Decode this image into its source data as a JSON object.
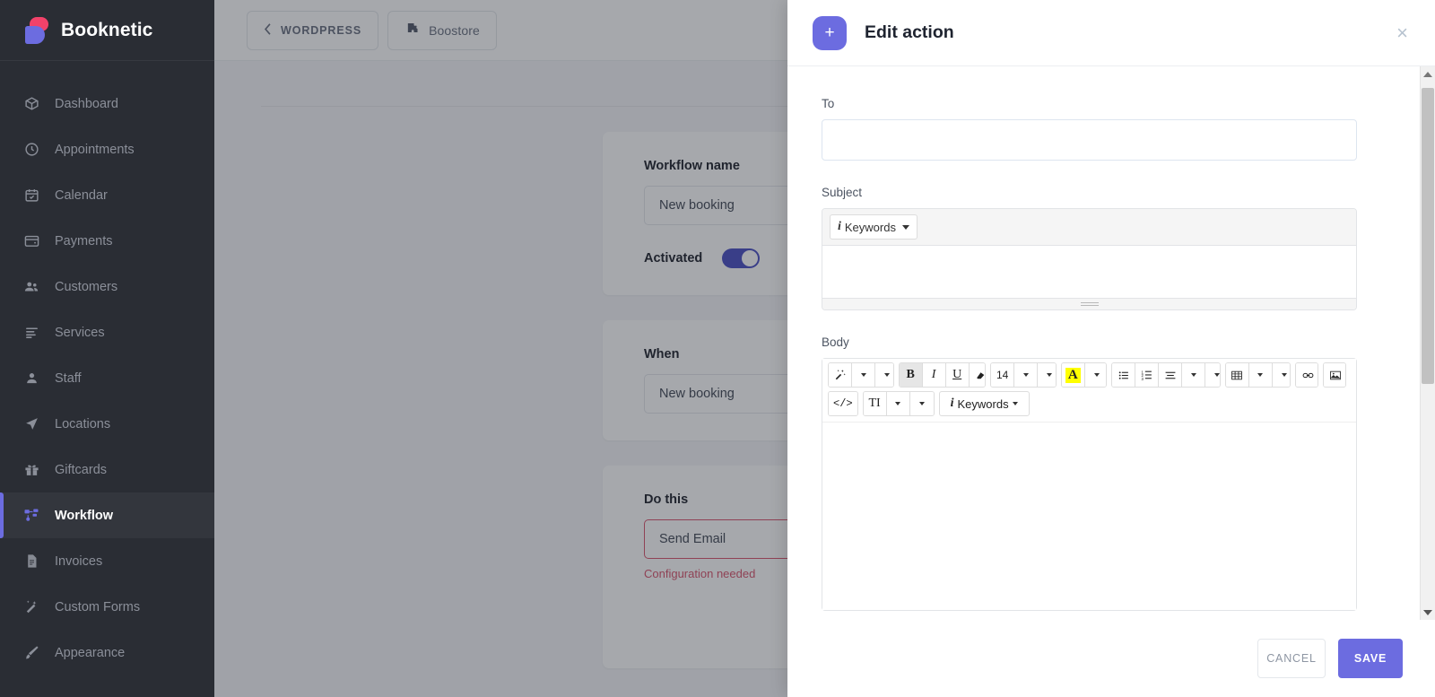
{
  "sidebar": {
    "brand": "Booknetic",
    "items": [
      {
        "label": "Dashboard",
        "icon": "box-icon",
        "active": false
      },
      {
        "label": "Appointments",
        "icon": "clock-icon",
        "active": false
      },
      {
        "label": "Calendar",
        "icon": "calendar-icon",
        "active": false
      },
      {
        "label": "Payments",
        "icon": "wallet-icon",
        "active": false
      },
      {
        "label": "Customers",
        "icon": "users-icon",
        "active": false
      },
      {
        "label": "Services",
        "icon": "list-icon",
        "active": false
      },
      {
        "label": "Staff",
        "icon": "user-icon",
        "active": false
      },
      {
        "label": "Locations",
        "icon": "navigation-icon",
        "active": false
      },
      {
        "label": "Giftcards",
        "icon": "gift-icon",
        "active": false
      },
      {
        "label": "Workflow",
        "icon": "workflow-icon",
        "active": true
      },
      {
        "label": "Invoices",
        "icon": "document-icon",
        "active": false
      },
      {
        "label": "Custom Forms",
        "icon": "magic-wand-icon",
        "active": false
      },
      {
        "label": "Appearance",
        "icon": "paintbrush-icon",
        "active": false
      }
    ]
  },
  "topbar": {
    "back_label": "WORDPRESS",
    "boostore_label": "Boostore"
  },
  "workflow": {
    "name_label": "Workflow name",
    "name_value": "New booking",
    "activated_label": "Activated",
    "activated": true,
    "when_label": "When",
    "when_value": "New booking",
    "do_this_label": "Do this",
    "do_this_value": "Send Email",
    "do_this_error": "Configuration needed",
    "action_button": ""
  },
  "modal": {
    "title": "Edit action",
    "add_icon": "+",
    "close_icon": "×",
    "to": {
      "label": "To",
      "value": "",
      "placeholder": ""
    },
    "subject": {
      "label": "Subject",
      "value": "",
      "keywords_label": "Keywords"
    },
    "body": {
      "label": "Body",
      "value": "",
      "keywords_label": "Keywords",
      "font_size": "14",
      "toolbar_row1": [
        {
          "name": "style-magic-icon",
          "glyph": "✨"
        },
        {
          "name": "bold-button",
          "glyph": "B"
        },
        {
          "name": "italic-button",
          "glyph": "I"
        },
        {
          "name": "underline-button",
          "glyph": "U"
        },
        {
          "name": "remove-format-button",
          "glyph": "▰"
        },
        {
          "name": "font-size-button",
          "glyph": "14"
        },
        {
          "name": "font-color-button",
          "glyph": "A"
        },
        {
          "name": "unordered-list-button",
          "glyph": "☰"
        },
        {
          "name": "ordered-list-button",
          "glyph": "☷"
        },
        {
          "name": "paragraph-align-button",
          "glyph": "≡"
        },
        {
          "name": "table-button",
          "glyph": "▦"
        },
        {
          "name": "link-button",
          "glyph": "⚭"
        },
        {
          "name": "picture-button",
          "glyph": "ὛC"
        }
      ],
      "toolbar_row2": [
        {
          "name": "code-view-button",
          "glyph": "</>"
        },
        {
          "name": "text-style-button",
          "glyph": "TI"
        },
        {
          "name": "keywords-button",
          "glyph": "Keywords"
        }
      ]
    },
    "cancel_label": "CANCEL",
    "save_label": "SAVE"
  },
  "colors": {
    "accent": "#6c6ce0",
    "sidebar_bg": "#2a2d34",
    "error": "#d9566f",
    "highlight": "#ffff00",
    "toggle_on": "#4a4fc4"
  }
}
